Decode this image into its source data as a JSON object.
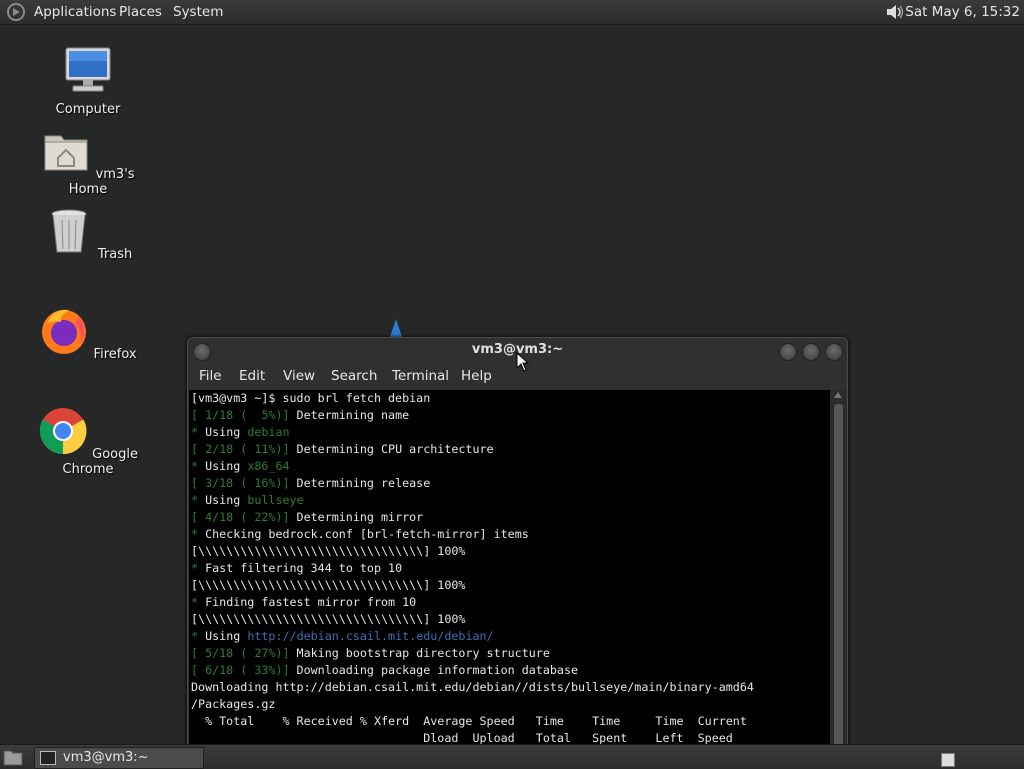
{
  "top_panel": {
    "menus": [
      "Applications",
      "Places",
      "System"
    ],
    "clock": "Sat May  6, 15:32",
    "icons": [
      "gnome-foot-logo-icon",
      "volume-icon"
    ]
  },
  "desktop": {
    "icons": [
      {
        "label": "Computer",
        "icon": "computer-icon"
      },
      {
        "label": "vm3's Home",
        "icon": "home-folder-icon"
      },
      {
        "label": "Trash",
        "icon": "trash-icon"
      },
      {
        "label": "Firefox",
        "icon": "firefox-icon"
      },
      {
        "label": "Google Chrome",
        "icon": "chrome-icon"
      }
    ]
  },
  "window": {
    "title": "vm3@vm3:~",
    "menu": [
      "File",
      "Edit",
      "View",
      "Search",
      "Terminal",
      "Help"
    ],
    "terminal_lines": [
      [
        [
          "",
          "[vm3@vm3 ~]$ sudo brl fetch debian"
        ]
      ],
      [
        [
          "g",
          "[ 1/18 (  5%)]"
        ],
        [
          "",
          " Determining name"
        ]
      ],
      [
        [
          "g",
          "*"
        ],
        [
          "",
          " Using "
        ],
        [
          "g",
          "debian"
        ]
      ],
      [
        [
          "g",
          "[ 2/18 ( 11%)]"
        ],
        [
          "",
          " Determining CPU architecture"
        ]
      ],
      [
        [
          "g",
          "*"
        ],
        [
          "",
          " Using "
        ],
        [
          "g",
          "x86_64"
        ]
      ],
      [
        [
          "g",
          "[ 3/18 ( 16%)]"
        ],
        [
          "",
          " Determining release"
        ]
      ],
      [
        [
          "g",
          "*"
        ],
        [
          "",
          " Using "
        ],
        [
          "g",
          "bullseye"
        ]
      ],
      [
        [
          "g",
          "[ 4/18 ( 22%)]"
        ],
        [
          "",
          " Determining mirror"
        ]
      ],
      [
        [
          "g",
          "*"
        ],
        [
          "",
          " Checking bedrock.conf [brl-fetch-mirror] items"
        ]
      ],
      [
        [
          "",
          "[\\\\\\\\\\\\\\\\\\\\\\\\\\\\\\\\\\\\\\\\\\\\\\\\\\\\\\\\\\\\\\\\] 100%"
        ]
      ],
      [
        [
          "g",
          "*"
        ],
        [
          "",
          " Fast filtering 344 to top 10"
        ]
      ],
      [
        [
          "",
          "[\\\\\\\\\\\\\\\\\\\\\\\\\\\\\\\\\\\\\\\\\\\\\\\\\\\\\\\\\\\\\\\\] 100%"
        ]
      ],
      [
        [
          "g",
          "*"
        ],
        [
          "",
          " Finding fastest mirror from 10"
        ]
      ],
      [
        [
          "",
          "[\\\\\\\\\\\\\\\\\\\\\\\\\\\\\\\\\\\\\\\\\\\\\\\\\\\\\\\\\\\\\\\\] 100%"
        ]
      ],
      [
        [
          "g",
          "*"
        ],
        [
          "",
          " Using "
        ],
        [
          "b",
          "http://debian.csail.mit.edu/debian/"
        ]
      ],
      [
        [
          "g",
          "[ 5/18 ( 27%)]"
        ],
        [
          "",
          " Making bootstrap directory structure"
        ]
      ],
      [
        [
          "g",
          "[ 6/18 ( 33%)]"
        ],
        [
          "",
          " Downloading package information database"
        ]
      ],
      [
        [
          "",
          "Downloading http://debian.csail.mit.edu/debian//dists/bullseye/main/binary-amd64"
        ]
      ],
      [
        [
          "",
          "/Packages.gz"
        ]
      ],
      [
        [
          "",
          "  % Total    % Received % Xferd  Average Speed   Time    Time     Time  Current"
        ]
      ],
      [
        [
          "",
          "                                 Dload  Upload   Total   Spent    Left  Speed"
        ]
      ]
    ]
  },
  "bottom_panel": {
    "task_label": "vm3@vm3:~"
  },
  "colors": {
    "green": "#2e7d32",
    "blue": "#3e6fb3",
    "desktop_bg": "#262727"
  }
}
